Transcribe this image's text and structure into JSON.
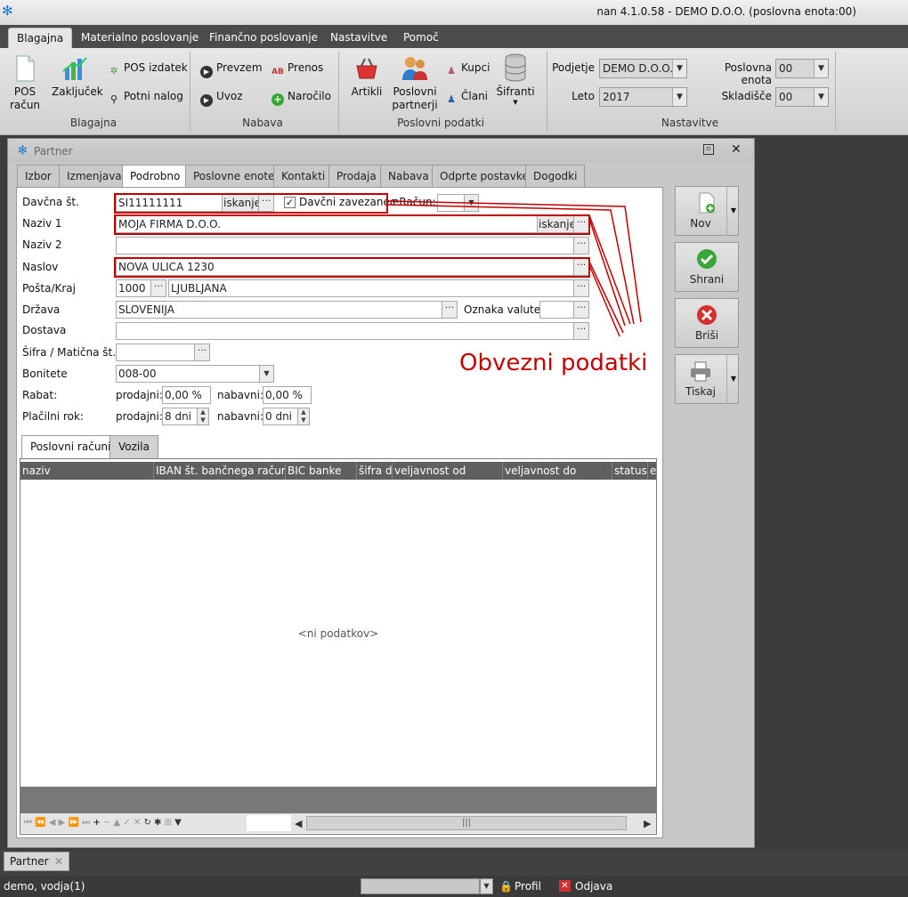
{
  "app": {
    "logo": "snowflake-icon",
    "title": "nan 4.1.0.58 - DEMO D.O.O. (poslovna enota:00)"
  },
  "menu": [
    "Blagajna",
    "Materialno poslovanje",
    "Finančno poslovanje",
    "Nastavitve",
    "Pomoč"
  ],
  "ribbon": {
    "blagajna": {
      "pos": "POS\nračun",
      "pos_l1": "POS",
      "pos_l2": "račun",
      "zakljucek": "Zaključek",
      "pos_izdatek": "POS izdatek",
      "potni_nalog": "Potni nalog",
      "group": "Blagajna"
    },
    "nabava": {
      "prevzem": "Prevzem",
      "uvoz": "Uvoz",
      "prenos": "Prenos",
      "narocilo": "Naročilo",
      "group": "Nabava"
    },
    "poslovni": {
      "artikli": "Artikli",
      "partnerji_l1": "Poslovni",
      "partnerji_l2": "partnerji",
      "kupci": "Kupci",
      "clani": "Člani",
      "sifranti": "Šifranti",
      "group": "Poslovni podatki"
    },
    "nastavitve": {
      "podjetje_label": "Podjetje",
      "podjetje": "DEMO D.O.O.",
      "leto_label": "Leto",
      "leto": "2017",
      "enota_label": "Poslovna enota",
      "enota": "00",
      "skladisce_label": "Skladišče",
      "skladisce": "00",
      "group": "Nastavitve"
    }
  },
  "window": {
    "title": "Partner"
  },
  "tabs": [
    "Izbor",
    "Izmenjava",
    "Podrobno",
    "Poslovne enote",
    "Kontakti",
    "Prodaja",
    "Nabava",
    "Odprte postavke",
    "Dogodki"
  ],
  "active_tab": "Podrobno",
  "form": {
    "davcna_label": "Davčna št.",
    "davcna": "SI11111111",
    "iskanje": "iskanje",
    "davcni_zavezanec": "Davčni zavezanec",
    "davcni_checked": true,
    "eracun_label": "eRačun:",
    "naziv1_label": "Naziv 1",
    "naziv1": "MOJA FIRMA D.O.O.",
    "naziv2_label": "Naziv 2",
    "naziv2": "",
    "naslov_label": "Naslov",
    "naslov": "NOVA ULICA 1230",
    "posta_label": "Pošta/Kraj",
    "posta": "1000",
    "kraj": "LJUBLJANA",
    "drzava_label": "Država",
    "drzava": "SLOVENIJA",
    "valuta_label": "Oznaka valute",
    "dostava_label": "Dostava",
    "sifra_label": "Šifra / Matična št.",
    "bonitete_label": "Bonitete",
    "bonitete": "008-00",
    "rabat_label": "Rabat:",
    "prodajni": "prodajni:",
    "nabavni": "nabavni:",
    "rabat_prodajni": "0,00 %",
    "rabat_nabavni": "0,00 %",
    "placilni_label": "Plačilni rok:",
    "rok_prodajni": "8 dni",
    "rok_nabavni": "0 dni"
  },
  "annotation": "Obvezni podatki",
  "subtabs": [
    "Poslovni računi",
    "Vozila"
  ],
  "grid": {
    "columns": [
      "naziv",
      "IBAN št. bančnega računa",
      "BIC banke",
      "šifra dr",
      "veljavnost od",
      "veljavnost do",
      "status",
      "e"
    ],
    "empty": "<ni podatkov>"
  },
  "actions": {
    "nov": "Nov",
    "shrani": "Shrani",
    "brisi": "Briši",
    "tiskaj": "Tiskaj"
  },
  "taskbar": {
    "item": "Partner"
  },
  "status": {
    "user": "demo, vodja(1)",
    "profil": "Profil",
    "odjava": "Odjava"
  },
  "colors": {
    "annotation": "#c00000",
    "ribbon_bg": "#dcdcdc",
    "dark_bar": "#4b4b4b",
    "accent": "#1976d2"
  }
}
